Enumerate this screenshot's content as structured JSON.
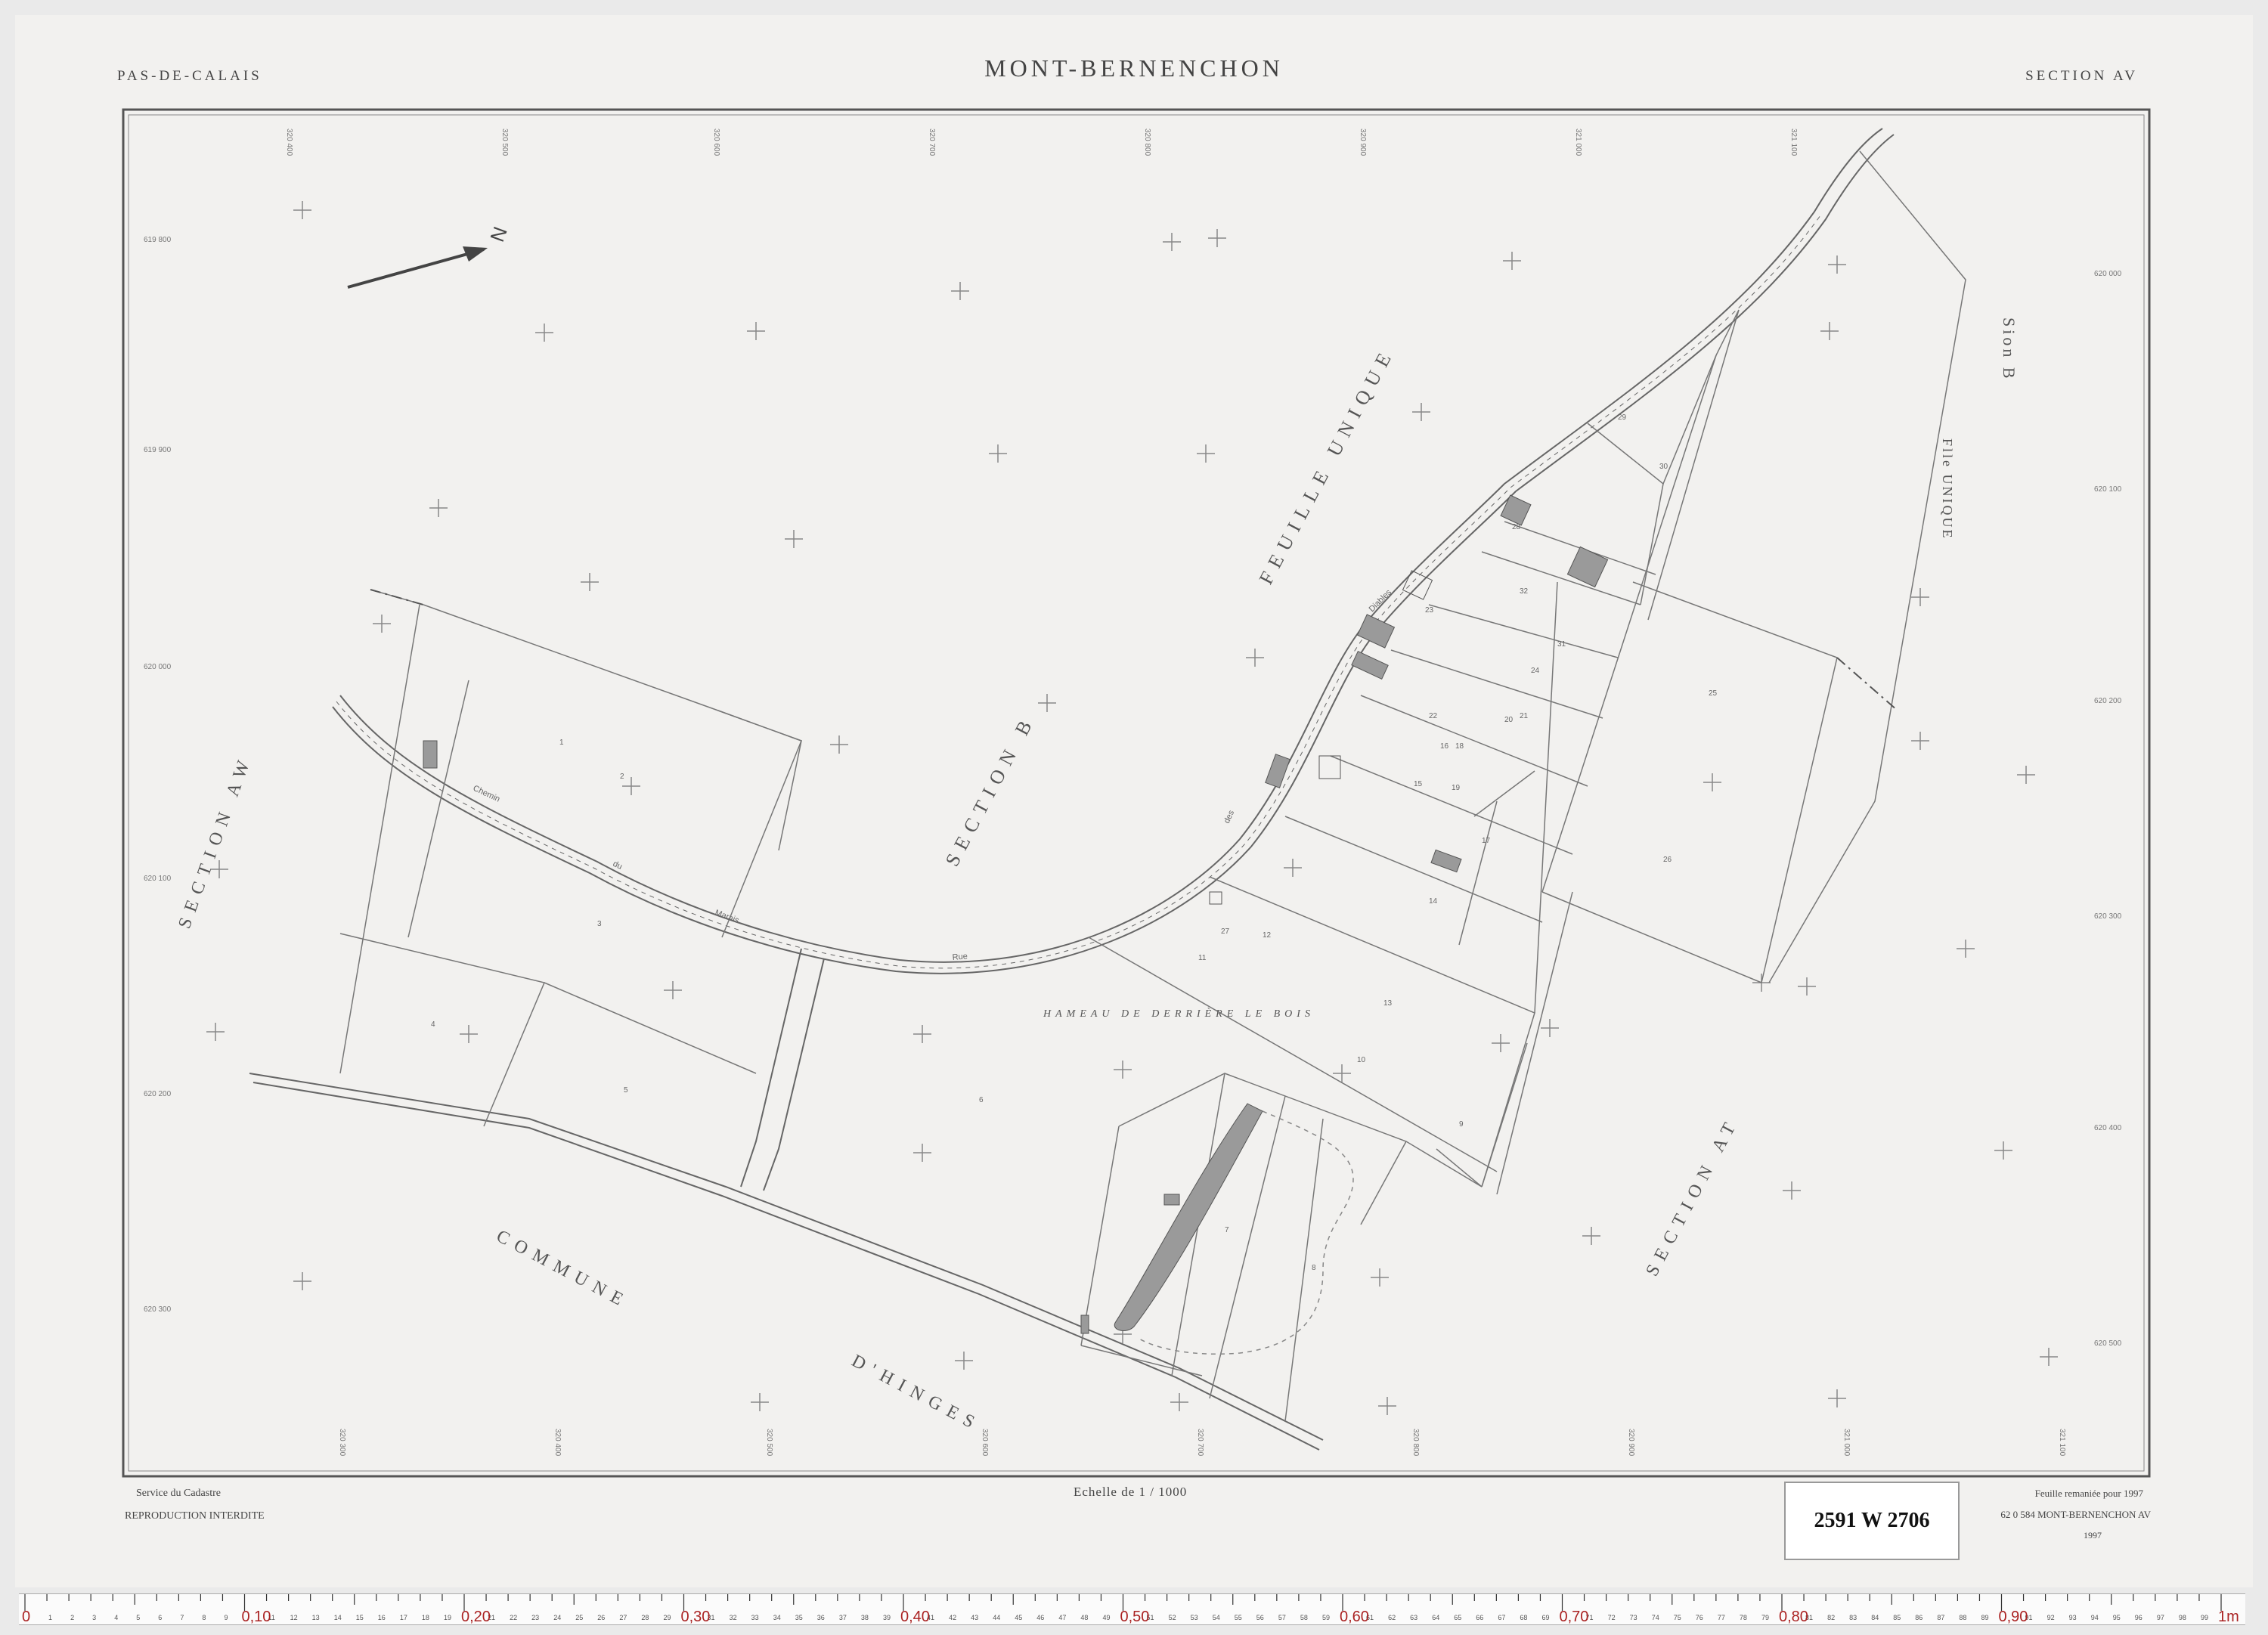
{
  "header": {
    "department": "PAS-DE-CALAIS",
    "commune": "MONT-BERNENCHON",
    "section": "SECTION AV"
  },
  "map_labels": {
    "section_b": "SECTION B",
    "feuille_unique": "FEUILLE UNIQUE",
    "section_aw": "SECTION AW",
    "section_at": "SECTION AT",
    "hameau": "HAMEAU DE DERRIÈRE LE BOIS",
    "commune_hinges_1": "COMMUNE",
    "commune_hinges_2": "D'HINGES",
    "right_section_b": "Sion B",
    "right_feuille": "Flle UNIQUE",
    "north": "N",
    "road_1": "Chemin",
    "road_2": "du",
    "road_3": "Marais",
    "road_4": "Rue",
    "road_5": "des",
    "road_6": "Diables"
  },
  "parcels": [
    "1",
    "2",
    "3",
    "4",
    "5",
    "6",
    "7",
    "8",
    "9",
    "10",
    "11",
    "12",
    "13",
    "14",
    "15",
    "16",
    "17",
    "18",
    "19",
    "20",
    "21",
    "22",
    "23",
    "24",
    "25",
    "26",
    "27",
    "28",
    "29",
    "30",
    "31",
    "32"
  ],
  "grid_labels": {
    "top": [
      "320 400",
      "320 500",
      "320 600",
      "320 700",
      "320 800",
      "320 900",
      "321 000",
      "321 100"
    ],
    "bottom": [
      "320 300",
      "320 400",
      "320 500",
      "320 600",
      "320 700",
      "320 800",
      "320 900",
      "321 000",
      "321 100"
    ],
    "left": [
      "619 800",
      "619 900",
      "620 000",
      "620 100",
      "620 200",
      "620 300"
    ],
    "right": [
      "620 000",
      "620 100",
      "620 200",
      "620 300",
      "620 400",
      "620 500"
    ]
  },
  "footer": {
    "service": "Service du Cadastre",
    "reproduction": "REPRODUCTION INTERDITE",
    "scale": "Echelle de 1 / 1000",
    "remaniee": "Feuille remaniée pour 1997",
    "reference": "62 0 584 MONT-BERNENCHON AV",
    "year": "1997",
    "archive_code": "2591 W 2706"
  },
  "ruler": {
    "unit": "1m",
    "major_labels": [
      "0",
      "0,10",
      "0,20",
      "0,30",
      "0,40",
      "0,50",
      "0,60",
      "0,70",
      "0,80",
      "0,90",
      "1m"
    ]
  }
}
